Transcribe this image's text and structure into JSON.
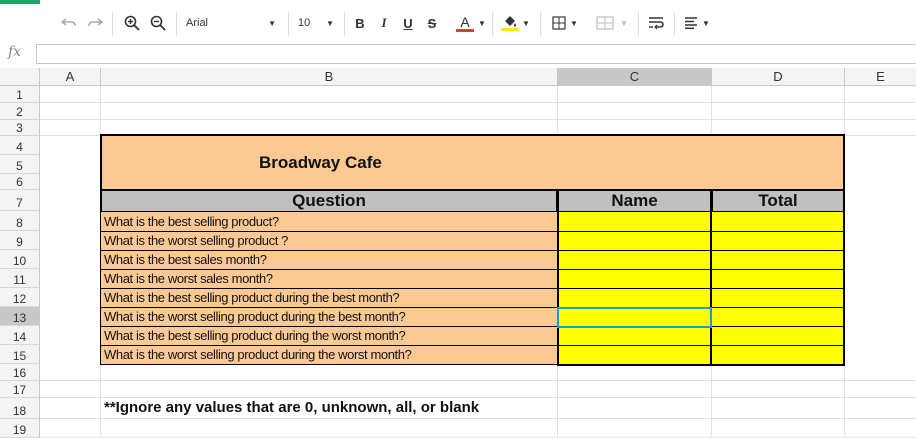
{
  "toolbar": {
    "undo_icon": "undo-icon",
    "redo_icon": "redo-icon",
    "zoom_in_icon": "zoom-in-icon",
    "zoom_out_icon": "zoom-out-icon",
    "font_name": "Arial",
    "font_size": "10",
    "bold": "B",
    "italic": "I",
    "underline": "U",
    "strike": "S",
    "font_color": "A",
    "font_color_bar": "#e53935",
    "fill_color_bar": "#f5e71c"
  },
  "formula_bar": {
    "fx_label": "fx",
    "value": ""
  },
  "columns": [
    "A",
    "B",
    "C",
    "D",
    "E"
  ],
  "rows": [
    "1",
    "2",
    "3",
    "4",
    "5",
    "6",
    "7",
    "8",
    "9",
    "10",
    "11",
    "12",
    "13",
    "14",
    "15",
    "16",
    "17",
    "18",
    "19"
  ],
  "selected_cell": "C13",
  "sheet": {
    "title": "Broadway Cafe",
    "headers": {
      "question": "Question",
      "name": "Name",
      "total": "Total"
    },
    "questions": [
      "What is the best selling product?",
      "What is the worst selling product ?",
      "What is the best sales month?",
      "What is the worst sales month?",
      "What is the best selling product during the best month?",
      "What is the worst selling product during the best month?",
      "What is the best selling product during the worst month?",
      "What is the worst selling product during the worst month?"
    ],
    "note": "**Ignore any values that are 0, unknown, all, or blank"
  },
  "colors": {
    "peach": "#fcc995",
    "yellow": "#ffff00",
    "header_grey": "#c0c0c0",
    "selection": "#1a9bd7"
  }
}
